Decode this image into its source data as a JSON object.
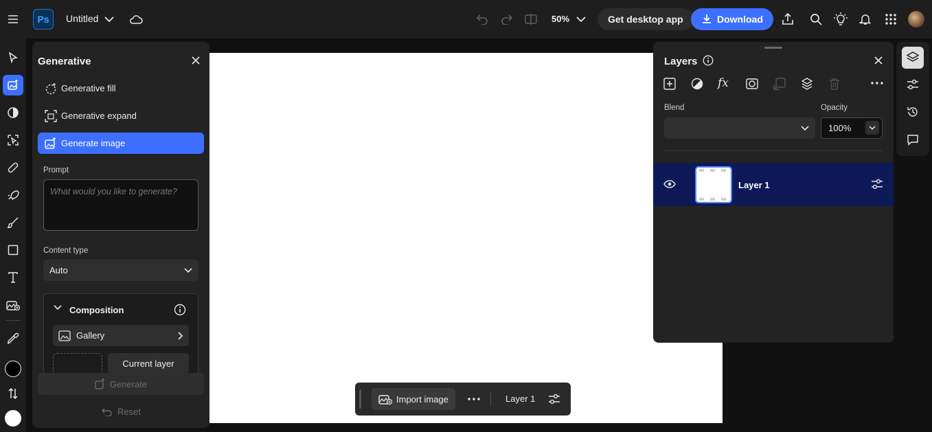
{
  "app": {
    "logo_text": "Ps",
    "doc_title": "Untitled"
  },
  "topbar": {
    "zoom": "50%",
    "get_desktop_label": "Get desktop app",
    "download_label": "Download"
  },
  "generative": {
    "title": "Generative",
    "items": [
      {
        "label": "Generative fill",
        "icon": "generative-fill-icon"
      },
      {
        "label": "Generative expand",
        "icon": "generative-expand-icon"
      },
      {
        "label": "Generate image",
        "icon": "generate-image-icon",
        "selected": true
      }
    ],
    "prompt_label": "Prompt",
    "prompt_placeholder": "What would you like to generate?",
    "content_type_label": "Content type",
    "content_type_value": "Auto",
    "composition_title": "Composition",
    "gallery_label": "Gallery",
    "current_layer_label": "Current layer",
    "generate_label": "Generate",
    "reset_label": "Reset"
  },
  "layers": {
    "title": "Layers",
    "blend_label": "Blend",
    "blend_value": "",
    "opacity_label": "Opacity",
    "opacity_value": "100%",
    "items": [
      {
        "name": "Layer 1",
        "visible": true,
        "selected": true
      }
    ]
  },
  "bottombar": {
    "import_label": "Import image",
    "layer_label": "Layer 1"
  },
  "colors": {
    "accent": "#3d6fff",
    "panel": "#232323",
    "layer_selected": "#0d1a57",
    "foreground_swatch": "#000000",
    "background_swatch": "#ffffff"
  }
}
